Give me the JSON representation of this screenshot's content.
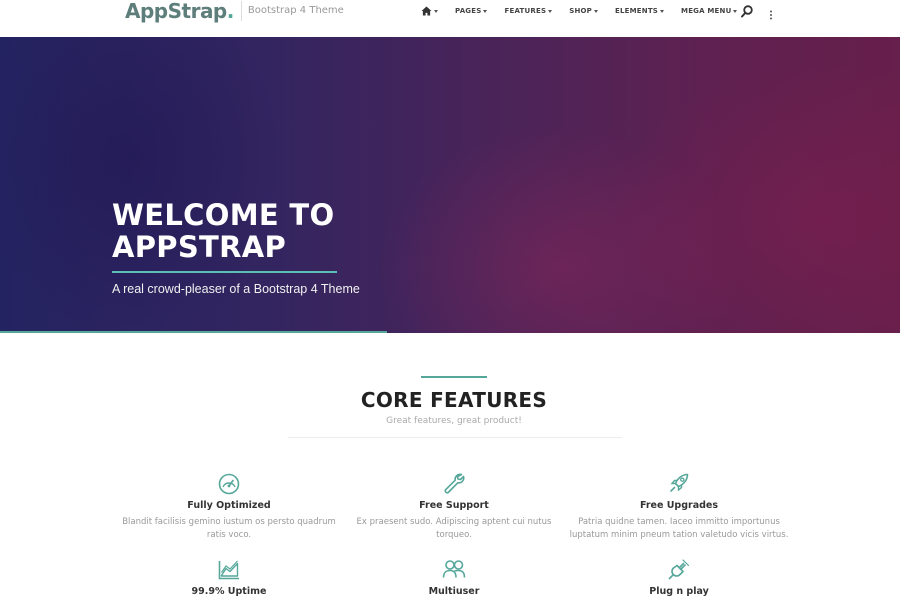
{
  "brand": {
    "name_main": "AppStrap",
    "name_dot": ".",
    "tagline": "Bootstrap 4 Theme"
  },
  "nav": {
    "items": [
      {
        "label": "PAGES"
      },
      {
        "label": "FEATURES"
      },
      {
        "label": "SHOP"
      },
      {
        "label": "ELEMENTS"
      },
      {
        "label": "MEGA MENU"
      }
    ],
    "icons": [
      "home-icon",
      "search-icon",
      "more-vertical-icon"
    ]
  },
  "hero": {
    "title_line1": "WELCOME TO",
    "title_line2": "APPSTRAP",
    "subtitle": "A real crowd-pleaser of a Bootstrap 4 Theme"
  },
  "features_section": {
    "title": "CORE FEATURES",
    "subtitle": "Great features, great product!",
    "items": [
      {
        "icon": "speedometer-icon",
        "title": "Fully Optimized",
        "desc": "Blandit facilisis gemino iustum os persto quadrum ratis voco."
      },
      {
        "icon": "wrench-icon",
        "title": "Free Support",
        "desc": "Ex praesent sudo. Adipiscing aptent cui nutus torqueo."
      },
      {
        "icon": "rocket-icon",
        "title": "Free Upgrades",
        "desc": "Patria quidne tamen. Iaceo immitto importunus luptatum minim pneum tation valetudo vicis virtus."
      },
      {
        "icon": "area-chart-icon",
        "title": "99.9% Uptime",
        "desc": ""
      },
      {
        "icon": "users-icon",
        "title": "Multiuser",
        "desc": ""
      },
      {
        "icon": "plug-icon",
        "title": "Plug n play",
        "desc": ""
      }
    ]
  },
  "colors": {
    "accent": "#55a79a",
    "hero_left": "#242361",
    "hero_right": "#671f4b",
    "heading": "#222222",
    "muted": "#999999"
  }
}
